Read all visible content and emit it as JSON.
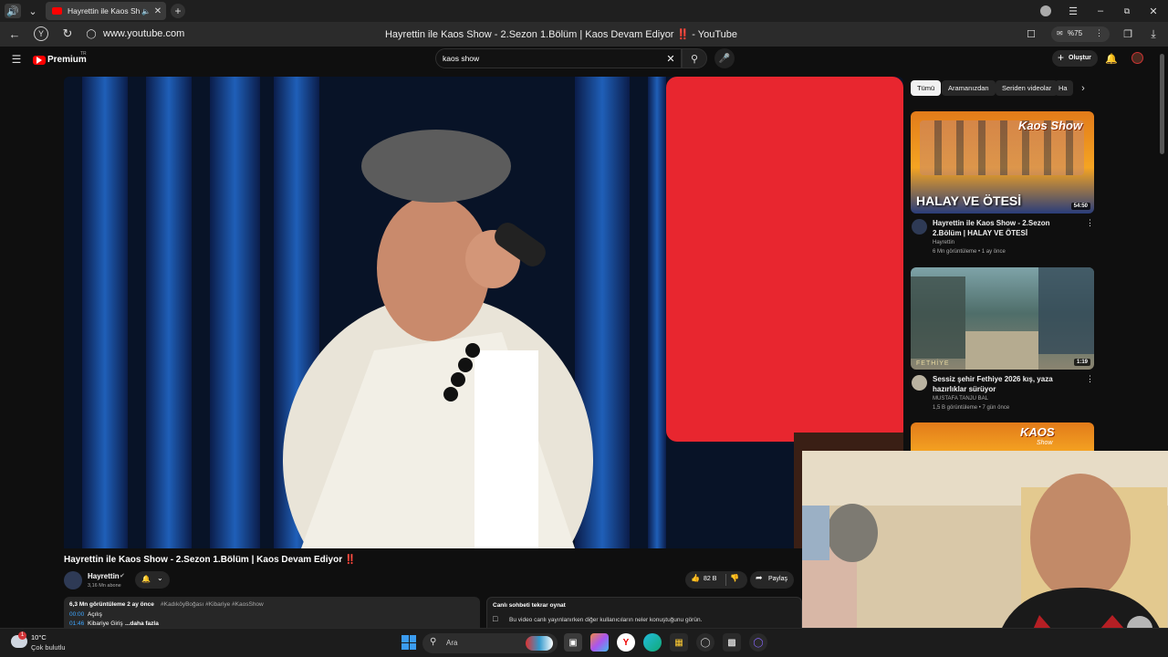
{
  "browser": {
    "tab_title": "Hayrettin ile Kaos Sh",
    "url": "www.youtube.com",
    "window_title": "Hayrettin ile Kaos Show - 2.Sezon 1.Bölüm | Kaos Devam Ediyor ‼️ - YouTube",
    "zoom": "%75"
  },
  "youtube": {
    "logo_label": "Premium",
    "logo_sup": "TR",
    "search_value": "kaos show",
    "create_label": "Oluştur",
    "chips": [
      "Tümü",
      "Aramanızdan",
      "Seriden videolar",
      "Ha"
    ]
  },
  "video": {
    "title": "Hayrettin ile Kaos Show - 2.Sezon 1.Bölüm | Kaos Devam Ediyor",
    "title_mark": "‼️",
    "channel": "Hayrettin",
    "subs": "3,16 Mn abone",
    "likes": "82 B",
    "share_label": "Paylaş",
    "desc_views": "6,3 Mn görüntüleme  2 ay önce",
    "desc_tags": "#KadıköyBoğası #Kibariye #KaosShow",
    "chapter1_time": "00:00",
    "chapter1_label": "Açılış",
    "chapter2_time": "01:46",
    "chapter2_label": "Kibariye Giriş",
    "more_label": "...daha fazla",
    "chat_title": "Canlı sohbeti tekrar oynat",
    "chat_desc": "Bu video canlı yayınlanırken diğer kullanıcıların neler konuştuğunu görün."
  },
  "sidebar_videos": [
    {
      "thumb_text_top": "Kaos Show",
      "thumb_text": "HALAY VE ÖTESİ",
      "duration": "54:50",
      "title": "Hayrettin ile Kaos Show - 2.Sezon 2.Bölüm | HALAY VE ÖTESİ",
      "channel": "Hayrettin",
      "meta": "6 Mn görüntüleme • 1 ay önce"
    },
    {
      "thumb_text": "FETHİYE",
      "duration": "1:19",
      "title": "Sessiz şehir Fethiye 2026 kış, yaza hazırlıklar sürüyor",
      "channel": "MUSTAFA TANJU BAL",
      "meta": "1,5 B görüntüleme • 7 gün önce"
    },
    {
      "thumb_text_top": "KAOS",
      "thumb_text": "Show"
    }
  ],
  "taskbar": {
    "weather_temp": "10°C",
    "weather_desc": "Çok bulutlu",
    "weather_badge": "1",
    "search_placeholder": "Ara"
  },
  "colors": {
    "yt_red": "#ff0000",
    "bg": "#0f0f0f",
    "chip_active": "#f1f1f1"
  }
}
